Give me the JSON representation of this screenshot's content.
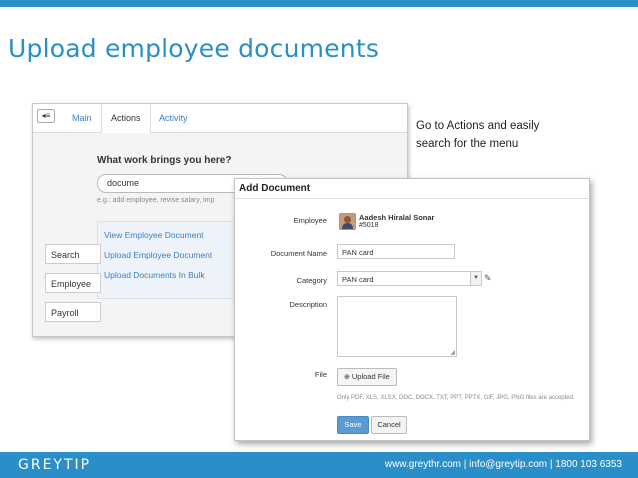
{
  "slide": {
    "title": "Upload employee documents",
    "note": "Go to Actions and easily search for the menu",
    "colors": {
      "brand": "#2a8fc8",
      "save_button": "#5b9bd5"
    }
  },
  "actions_panel": {
    "toggle_icon": "◂≡",
    "tabs": [
      "Main",
      "Actions",
      "Activity"
    ],
    "question": "What work brings you here?",
    "search_value": "docume",
    "hint": "e.g.: add employee, revise salary, imp",
    "suggestions": [
      "View Employee Document",
      "Upload Employee Document",
      "Upload Documents In Bulk"
    ],
    "side_buttons": [
      "Search",
      "Employee",
      "Payroll"
    ]
  },
  "dialog": {
    "title": "Add Document",
    "employee_label": "Employee",
    "employee_name": "Aadesh Hiralal Sonar",
    "employee_id": "#5018",
    "document_name_label": "Document Name",
    "document_name_value": "PAN card",
    "category_label": "Category",
    "category_value": "PAN card",
    "description_label": "Description",
    "file_label": "File",
    "upload_label": "Upload File",
    "file_hint": "Only PDF, XLS, XLSX, DOC, DOCX, TXT, PPT, PPTX, GIF, JPG, PNG files are accepted.",
    "save_label": "Save",
    "cancel_label": "Cancel"
  },
  "footer": {
    "logo": "GREYTIP",
    "contact": "www.greythr.com | info@greytip.com | 1800 103 6353"
  }
}
